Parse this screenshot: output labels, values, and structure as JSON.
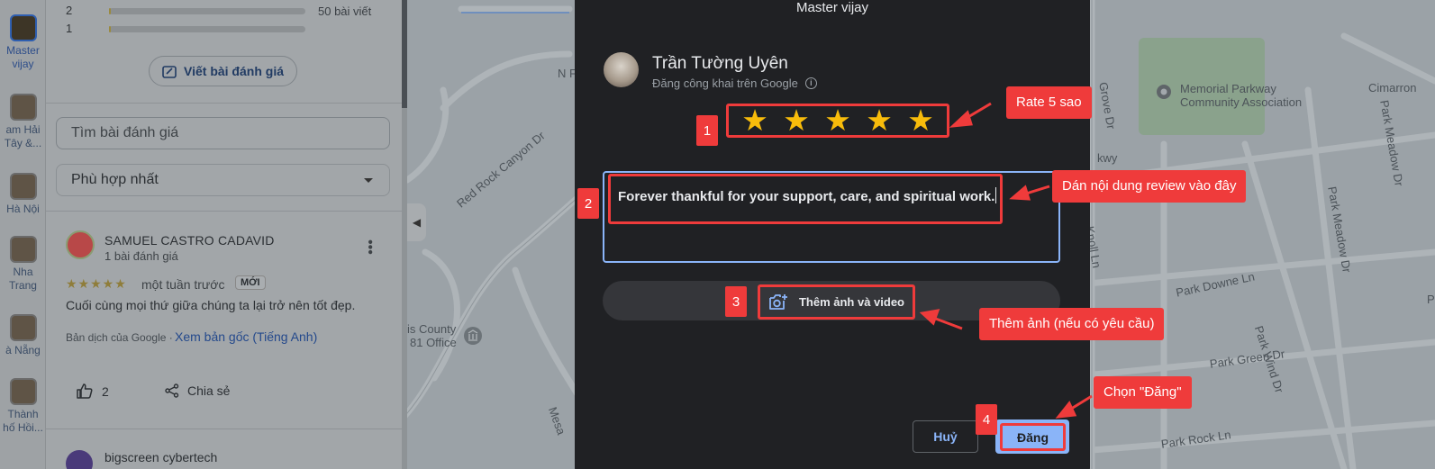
{
  "sidebar": {
    "items": [
      {
        "label": "Master\nvijay",
        "active": true
      },
      {
        "label": "am Hải\nTây &...",
        "active": false
      },
      {
        "label": "Hà Nội",
        "active": false
      },
      {
        "label": "Nha\nTrang",
        "active": false
      },
      {
        "label": "à Nẵng",
        "active": false
      },
      {
        "label": "Thành\nhố Hồi...",
        "active": false
      }
    ]
  },
  "reviews_panel": {
    "rating_rows": [
      {
        "star": "2",
        "fill_fraction": 0.01
      },
      {
        "star": "1",
        "fill_fraction": 0.01
      }
    ],
    "total_reviews": "50 bài viết",
    "write_review_label": "Viết bài đánh giá",
    "search_placeholder": "Tìm bài đánh giá",
    "sort_value": "Phù hợp nhất",
    "review": {
      "name": "SAMUEL CASTRO CADAVID",
      "count": "1 bài đánh giá",
      "stars": "★★★★★",
      "time": "một tuần trước",
      "badge": "MỚI",
      "text": "Cuối cùng mọi thứ giữa chúng ta lại trở nên tốt đẹp.",
      "translated_by": "Bản dịch của Google",
      "view_original": "Xem bản gốc (Tiếng Anh)",
      "likes": "2",
      "share_label": "Chia sẻ"
    },
    "next_reviewer": "bigscreen cybertech"
  },
  "map": {
    "labels": [
      "Red Rock Canyon Dr",
      "N Fo",
      "is County",
      "81 Office",
      "Memorial Parkway",
      "Community Association",
      "Cimarron",
      "Park Meadow Dr",
      "Park Meadow Dr",
      "Park Downe Ln",
      "Park Green Dr",
      "Park Wind Dr",
      "Park Rock Ln",
      "Grove Dr",
      "Mesa",
      "Knoll Ln",
      "kwy",
      "Pa"
    ]
  },
  "dialog": {
    "title": "Master vijay",
    "user_name": "Trần Tường Uyên",
    "user_sub": "Đăng công khai trên Google",
    "rating": 5,
    "stars": [
      "★",
      "★",
      "★",
      "★",
      "★"
    ],
    "review_text": "Forever thankful for your support, care, and spiritual work.",
    "add_media_label": "Thêm ảnh và video",
    "cancel_label": "Huỷ",
    "post_label": "Đăng"
  },
  "annotations": {
    "badges": [
      "1",
      "2",
      "3",
      "4"
    ],
    "callouts": [
      "Rate 5 sao",
      "Dán nội dung review vào đây",
      "Thêm ảnh (nếu có yêu cầu)",
      "Chọn \"Đăng\""
    ],
    "color": "#ef3b3b"
  }
}
